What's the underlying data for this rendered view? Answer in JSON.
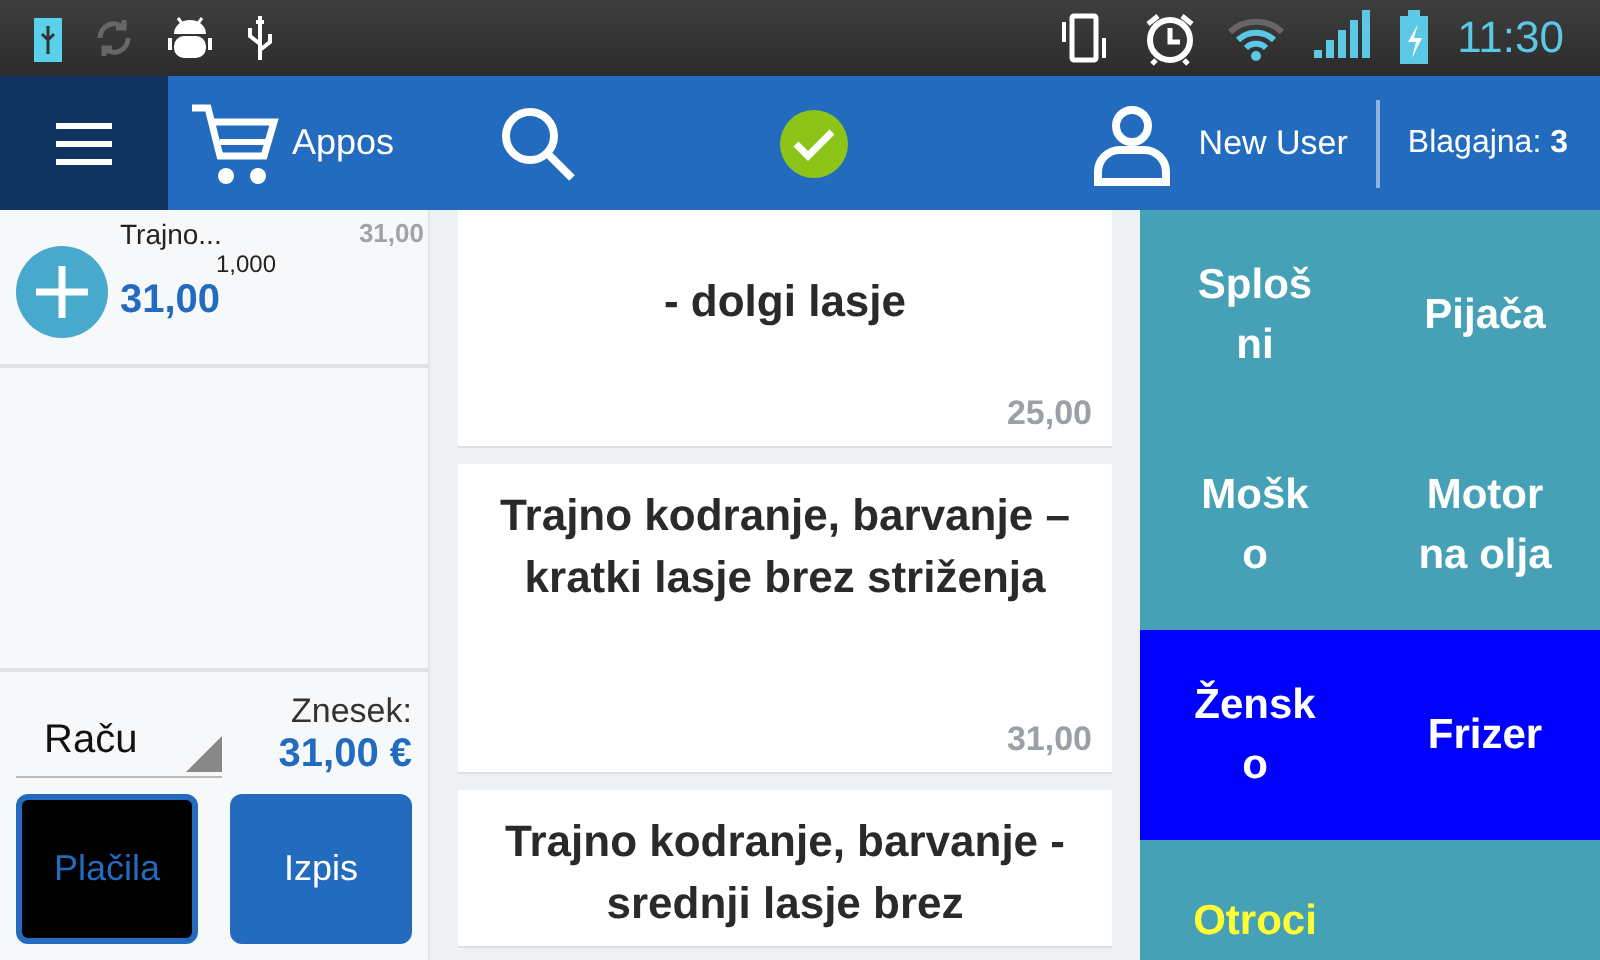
{
  "status_bar": {
    "time": "11:30"
  },
  "header": {
    "app_name": "Appos",
    "sync_ok": true,
    "user": "New User",
    "register": "Blagajna: **3**"
  },
  "order": {
    "lines": [
      {
        "name": "Trajno...",
        "price": "31,00",
        "quantity": "1,000",
        "total": "31,00"
      }
    ],
    "document_type": "Raču",
    "amount_label": "Znesek:",
    "amount": "31,00 €",
    "buttons": [
      {
        "label": "Plačila",
        "selected": true
      },
      {
        "label": "Izpis",
        "selected": false
      }
    ]
  },
  "products": [
    {
      "name": "- dolgi lasje",
      "price": "25,00"
    },
    {
      "name": "Trajno kodranje, barvanje – kratki lasje brez striženja",
      "price": "31,00"
    },
    {
      "name": "Trajno kodranje, barvanje - srednji lasje brez"
    }
  ],
  "categories": [
    {
      "label": "Splošni",
      "selected": false,
      "color": "#ffffff"
    },
    {
      "label": "Pijača",
      "selected": false,
      "color": "#ffffff"
    },
    {
      "label": "Moško",
      "selected": false,
      "color": "#ffffff"
    },
    {
      "label": "Motor na olja",
      "selected": false,
      "color": "#ffffff"
    },
    {
      "label": "Žensko",
      "selected": true,
      "color": "#ffffff"
    },
    {
      "label": "Frizer",
      "selected": true,
      "color": "#ffffff"
    },
    {
      "label": "Otroci",
      "selected": false,
      "color": "#ffff33"
    }
  ]
}
